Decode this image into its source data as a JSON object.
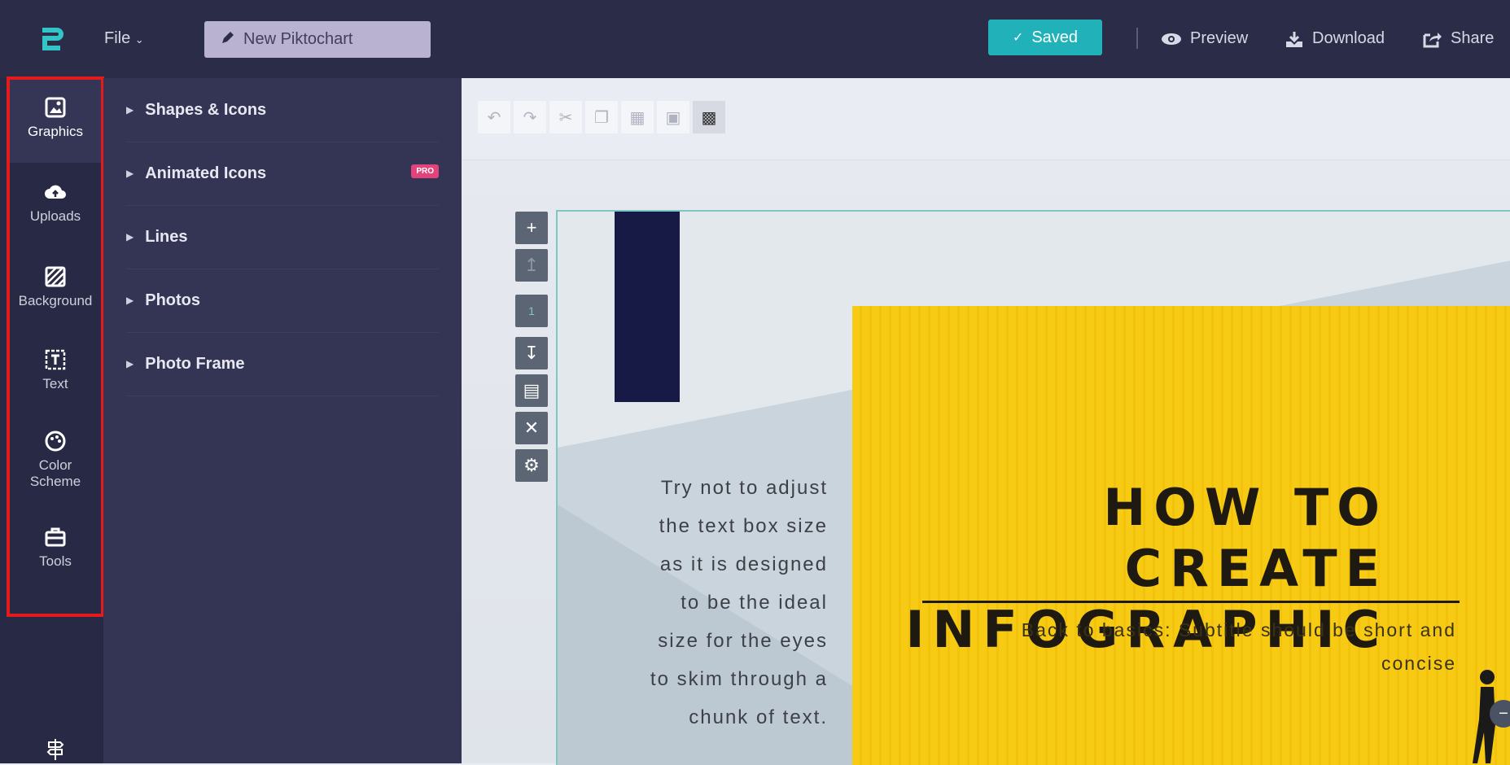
{
  "topbar": {
    "file_label": "File",
    "document_title": "New Piktochart",
    "saved_label": "Saved",
    "preview_label": "Preview",
    "download_label": "Download",
    "share_label": "Share"
  },
  "rail": {
    "items": [
      {
        "label": "Graphics",
        "icon": "image-icon"
      },
      {
        "label": "Uploads",
        "icon": "cloud-upload-icon"
      },
      {
        "label": "Background",
        "icon": "hatch-icon"
      },
      {
        "label": "Text",
        "icon": "text-box-icon"
      },
      {
        "label": "Color\nScheme",
        "line1": "Color",
        "line2": "Scheme",
        "icon": "palette-icon"
      },
      {
        "label": "Tools",
        "icon": "toolbox-icon"
      }
    ],
    "active": "Graphics"
  },
  "panel": {
    "items": [
      {
        "label": "Shapes & Icons"
      },
      {
        "label": "Animated Icons",
        "badge": "PRO"
      },
      {
        "label": "Lines"
      },
      {
        "label": "Photos"
      },
      {
        "label": "Photo Frame"
      }
    ]
  },
  "canvas": {
    "body_text_lines": [
      "Try not to adjust",
      "the text box size",
      "as it is designed",
      "to be the ideal",
      "size for the eyes",
      "to skim through a",
      "chunk of text."
    ],
    "headline_line1": "HOW TO CREATE",
    "headline_line2": "INFOGRAPHIC",
    "subtitle_line1": "Back to basics: Subtitle should be short and",
    "subtitle_line2": "concise",
    "block_tool_number": "1"
  },
  "colors": {
    "topbar": "#2b2c48",
    "panel": "#343454",
    "accent_saved": "#20b2b8",
    "pro_badge": "#e2437a",
    "yellow": "#f7cb13",
    "navy": "#161a44",
    "highlight": "#e51a1a"
  }
}
